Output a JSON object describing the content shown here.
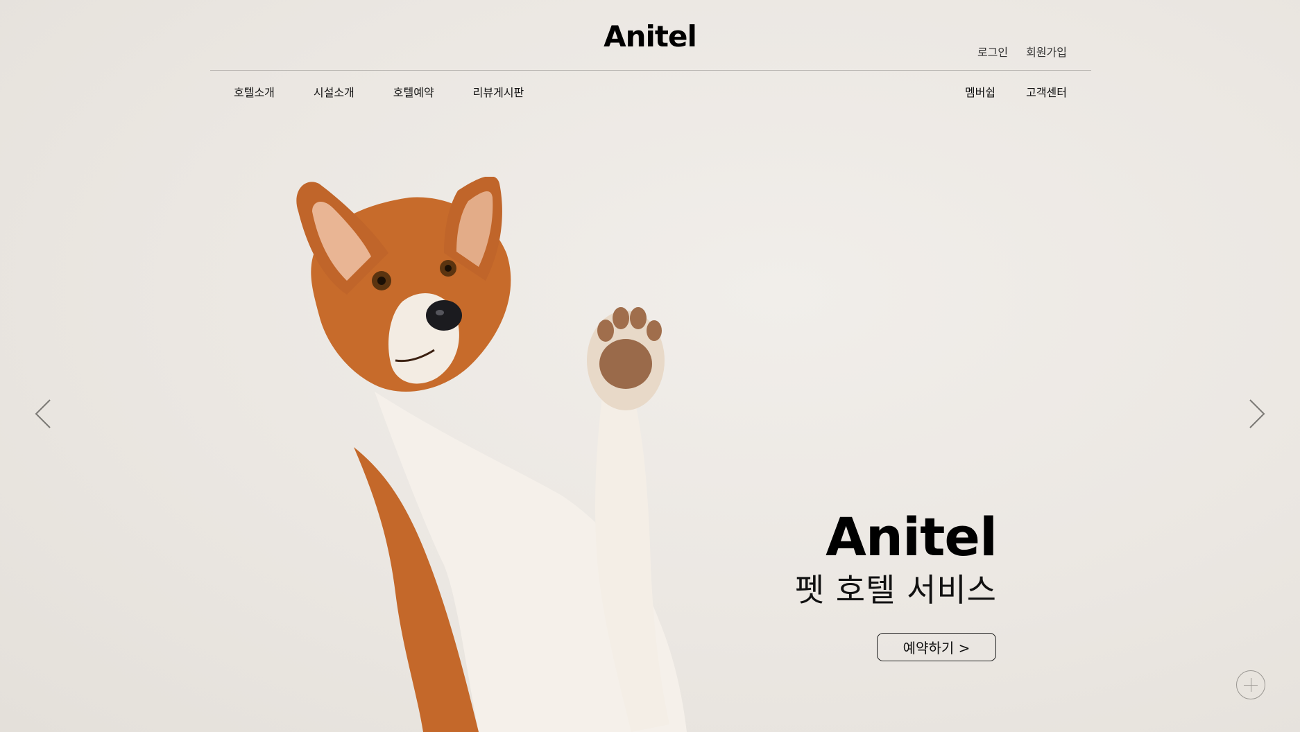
{
  "header": {
    "logo": "Anitel",
    "util_nav": [
      "로그인",
      "회원가입"
    ],
    "main_nav": [
      "호텔소개",
      "시설소개",
      "호텔예약",
      "리뷰게시판"
    ],
    "side_nav": [
      "멤버쉽",
      "고객센터"
    ]
  },
  "hero": {
    "title": "Anitel",
    "subtitle": "펫 호텔 서비스",
    "cta_label": "예약하기 >",
    "prev_icon": "chevron-left-icon",
    "next_icon": "chevron-right-icon",
    "plus_icon": "plus-circle-icon"
  },
  "colors": {
    "background": "#ebe7e2",
    "text": "#111111",
    "dog_orange": "#c46a2a",
    "dog_white": "#f4efe8"
  }
}
